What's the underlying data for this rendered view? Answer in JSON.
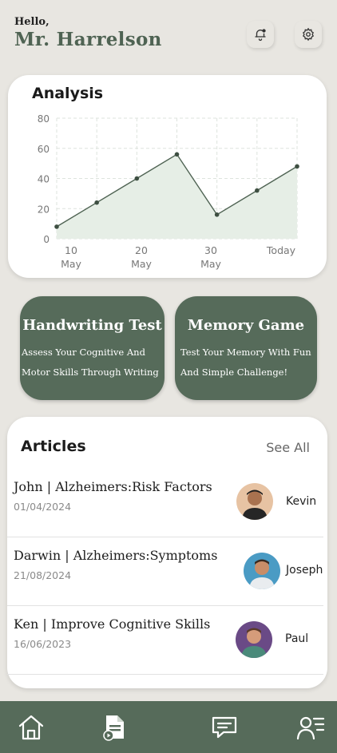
{
  "header": {
    "hello": "Hello,",
    "name": "Mr. Harrelson"
  },
  "icons": {
    "notifications": "bell-icon",
    "settings": "gear-icon"
  },
  "analysis": {
    "title": "Analysis",
    "chart_data": {
      "type": "area",
      "x": [
        "10 May",
        "",
        "20 May",
        "",
        "30 May",
        "",
        "Today"
      ],
      "y": [
        8,
        24,
        40,
        56,
        16,
        32,
        48
      ],
      "ylim": [
        0,
        80
      ],
      "yticks": [
        "80",
        "60",
        "40",
        "20",
        "0"
      ],
      "xtick_labels": [
        {
          "line1": "10",
          "line2": "May"
        },
        {
          "line1": "20",
          "line2": "May"
        },
        {
          "line1": "30",
          "line2": "May"
        },
        {
          "line1": "Today",
          "line2": ""
        }
      ],
      "grid": true,
      "color": "#4f6353",
      "fill": "#e6eee6"
    }
  },
  "features": [
    {
      "title": "Handwriting Test",
      "line1": "Assess Your Cognitive And",
      "line2": "Motor Skills Through Writing"
    },
    {
      "title": "Memory  Game",
      "line1": "Test Your Memory With Fun",
      "line2": "And Simple Challenge!"
    }
  ],
  "articles": {
    "title": "Articles",
    "see_all": "See All",
    "items": [
      {
        "title": "John | Alzheimers:Risk Factors",
        "date": "01/04/2024",
        "author": "Kevin"
      },
      {
        "title": "Darwin | Alzheimers:Symptoms",
        "date": "21/08/2024",
        "author": "Joseph"
      },
      {
        "title": "Ken | Improve Cognitive Skills",
        "date": "16/06/2023",
        "author": "Paul"
      }
    ]
  },
  "nav": [
    "home-icon",
    "report-icon",
    "chat-icon",
    "profile-menu-icon"
  ]
}
